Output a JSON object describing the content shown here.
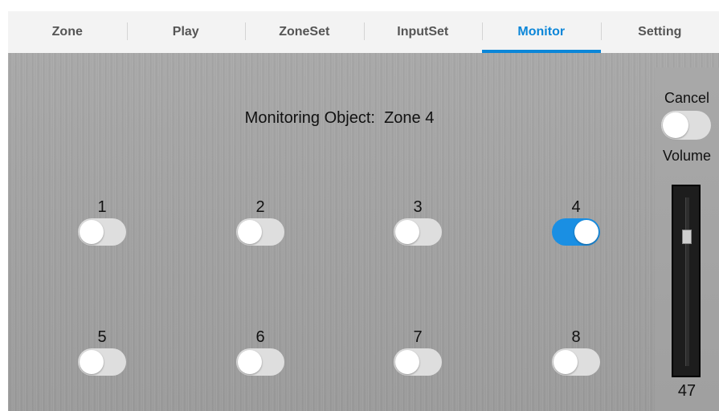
{
  "tabs": [
    {
      "label": "Zone",
      "active": false
    },
    {
      "label": "Play",
      "active": false
    },
    {
      "label": "ZoneSet",
      "active": false
    },
    {
      "label": "InputSet",
      "active": false
    },
    {
      "label": "Monitor",
      "active": true
    },
    {
      "label": "Setting",
      "active": false
    }
  ],
  "monitor": {
    "title_prefix": "Monitoring Object:",
    "title_value": "Zone 4"
  },
  "channels": [
    {
      "label": "1",
      "on": false
    },
    {
      "label": "2",
      "on": false
    },
    {
      "label": "3",
      "on": false
    },
    {
      "label": "4",
      "on": true
    },
    {
      "label": "5",
      "on": false
    },
    {
      "label": "6",
      "on": false
    },
    {
      "label": "7",
      "on": false
    },
    {
      "label": "8",
      "on": false
    }
  ],
  "side": {
    "cancel_label": "Cancel",
    "cancel_on": false,
    "volume_label": "Volume",
    "volume_value": "47"
  },
  "colors": {
    "accent": "#0b86d8",
    "toggle_on": "#1a8fe3",
    "toggle_off": "#dedede"
  }
}
